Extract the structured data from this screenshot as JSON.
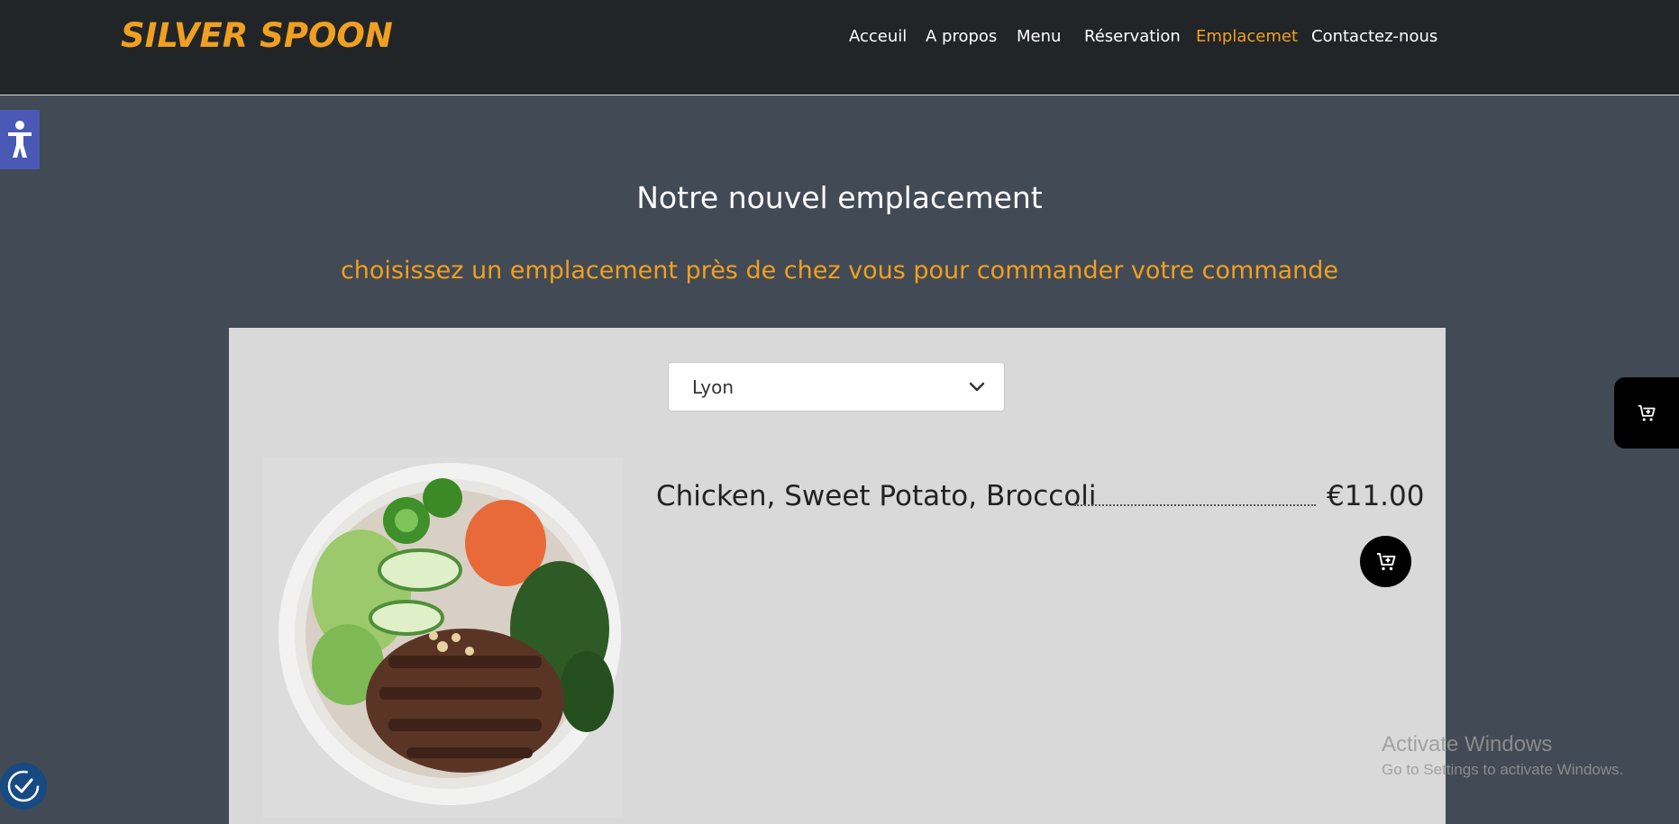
{
  "header": {
    "brand": "SILVER SPOON",
    "nav": [
      {
        "label": "Acceuil",
        "active": false
      },
      {
        "label": "A propos",
        "active": false
      },
      {
        "label": "Menu",
        "active": false
      },
      {
        "label": "Réservation",
        "active": false
      },
      {
        "label": "Emplacemet",
        "active": true
      },
      {
        "label": "Contactez-nous",
        "active": false
      }
    ]
  },
  "main": {
    "title": "Notre nouvel emplacement",
    "subtitle": "choisissez un emplacement près de chez vous pour commander votre commande",
    "location_select": {
      "value": "Lyon"
    },
    "menu_item": {
      "name": "Chicken, Sweet Potato, Broccoli",
      "price": "€11.00"
    }
  },
  "watermark": {
    "line1": "Activate Windows",
    "line2": "Go to Settings to activate Windows."
  },
  "colors": {
    "accent": "#f0a020",
    "header_bg": "#222527",
    "page_bg": "#424a55",
    "panel_bg": "#d9d9d9",
    "a11y_blue": "#4a59b6"
  },
  "icons": {
    "accessibility_side": "accessibility-person-icon",
    "accessibility_bottom": "accessibility-check-icon",
    "cart": "add-to-cart-icon",
    "select_chevron": "chevron-down-icon"
  }
}
